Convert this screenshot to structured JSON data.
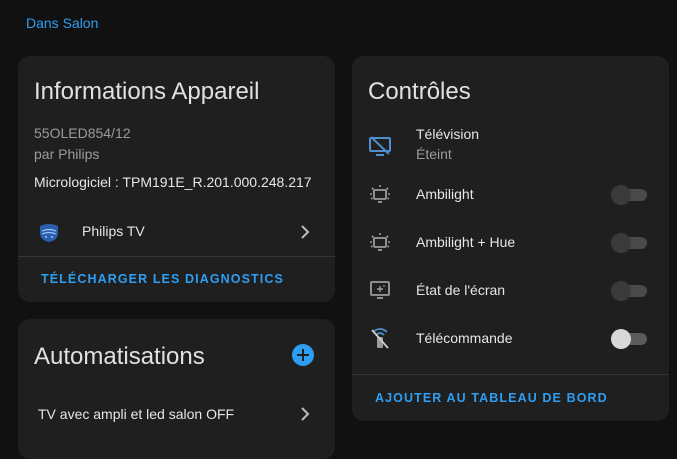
{
  "breadcrumb": "Dans Salon",
  "device_info": {
    "title": "Informations Appareil",
    "model": "55OLED854/12",
    "vendor": "par Philips",
    "firmware": "Micrologiciel : TPM191E_R.201.000.248.217",
    "integration": "Philips TV",
    "download_diagnostics": "TÉLÉCHARGER LES DIAGNOSTICS"
  },
  "automations": {
    "title": "Automatisations",
    "items": [
      {
        "label": "TV avec ampli et led salon OFF"
      }
    ]
  },
  "controls": {
    "title": "Contrôles",
    "television": {
      "name": "Télévision",
      "state": "Éteint"
    },
    "items": [
      {
        "name": "Ambilight"
      },
      {
        "name": "Ambilight + Hue"
      },
      {
        "name": "État de l'écran"
      },
      {
        "name": "Télécommande"
      }
    ],
    "add_to_dashboard": "AJOUTER AU TABLEAU DE BORD"
  },
  "colors": {
    "accent": "#2e9ef2",
    "tv_off_icon": "#4e8fce",
    "card_bg": "#1f1f1f",
    "page_bg": "#111111"
  }
}
